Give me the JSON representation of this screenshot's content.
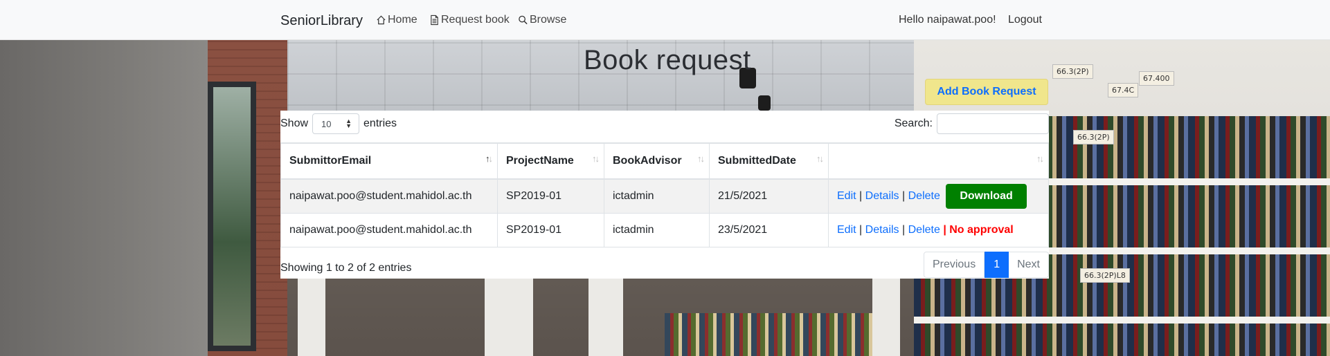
{
  "navbar": {
    "brand": "SeniorLibrary",
    "links": [
      {
        "label": "Home",
        "icon": "home-icon"
      },
      {
        "label": "Request book",
        "icon": "document-icon"
      },
      {
        "label": "Browse",
        "icon": "search-icon"
      }
    ],
    "greeting": "Hello naipawat.poo!",
    "logout": "Logout"
  },
  "page": {
    "title": "Book request",
    "add_button": "Add Book Request"
  },
  "table_controls": {
    "show_label": "Show",
    "entries_value": "10",
    "entries_label": "entries",
    "search_label": "Search:",
    "search_value": ""
  },
  "table": {
    "columns": [
      "SubmittorEmail",
      "ProjectName",
      "BookAdvisor",
      "SubmittedDate",
      ""
    ],
    "rows": [
      {
        "email": "naipawat.poo@student.mahidol.ac.th",
        "project": "SP2019-01",
        "advisor": "ictadmin",
        "date": "21/5/2021",
        "actions": {
          "edit": "Edit",
          "details": "Details",
          "delete": "Delete",
          "extra": "Download",
          "extra_type": "button"
        }
      },
      {
        "email": "naipawat.poo@student.mahidol.ac.th",
        "project": "SP2019-01",
        "advisor": "ictadmin",
        "date": "23/5/2021",
        "actions": {
          "edit": "Edit",
          "details": "Details",
          "delete": "Delete",
          "extra": "No approval",
          "extra_type": "status"
        }
      }
    ]
  },
  "footer": {
    "info": "Showing 1 to 2 of 2 entries",
    "pagination": {
      "previous": "Previous",
      "current": "1",
      "next": "Next"
    }
  },
  "colors": {
    "link": "#0d6efd",
    "download": "#008000",
    "no_approval": "#ff0000",
    "add_button_bg": "#f0e68c"
  }
}
